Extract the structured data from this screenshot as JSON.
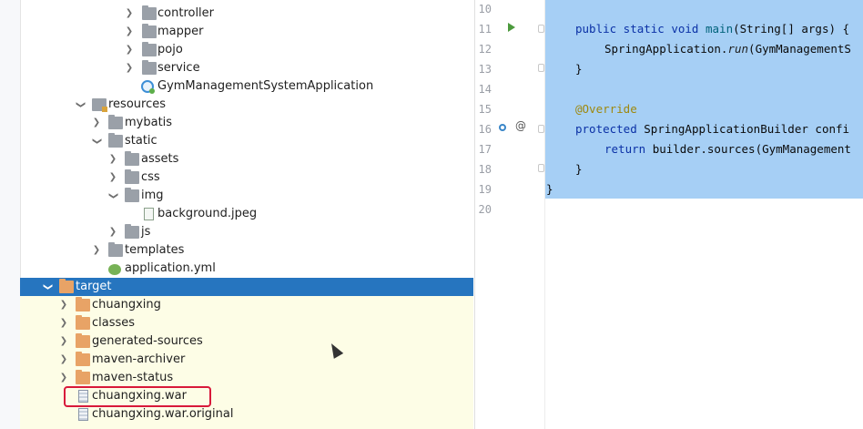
{
  "tree": {
    "items": [
      {
        "label": "controller",
        "type": "folder"
      },
      {
        "label": "mapper",
        "type": "folder"
      },
      {
        "label": "pojo",
        "type": "folder"
      },
      {
        "label": "service",
        "type": "folder"
      },
      {
        "label": "GymManagementSystemApplication",
        "type": "app-class"
      },
      {
        "label": "resources",
        "type": "resources-folder"
      },
      {
        "label": "mybatis",
        "type": "folder"
      },
      {
        "label": "static",
        "type": "folder"
      },
      {
        "label": "assets",
        "type": "folder"
      },
      {
        "label": "css",
        "type": "folder"
      },
      {
        "label": "img",
        "type": "folder"
      },
      {
        "label": "background.jpeg",
        "type": "file"
      },
      {
        "label": "js",
        "type": "folder"
      },
      {
        "label": "templates",
        "type": "folder"
      },
      {
        "label": "application.yml",
        "type": "yml"
      },
      {
        "label": "target",
        "type": "excluded-folder",
        "selected": true
      },
      {
        "label": "chuangxing",
        "type": "excluded-folder"
      },
      {
        "label": "classes",
        "type": "excluded-folder"
      },
      {
        "label": "generated-sources",
        "type": "excluded-folder"
      },
      {
        "label": "maven-archiver",
        "type": "excluded-folder"
      },
      {
        "label": "maven-status",
        "type": "excluded-folder"
      },
      {
        "label": "chuangxing.war",
        "type": "war",
        "highlighted": true
      },
      {
        "label": "chuangxing.war.original",
        "type": "war"
      }
    ]
  },
  "editor": {
    "line_numbers": [
      "10",
      "11",
      "12",
      "13",
      "14",
      "15",
      "16",
      "17",
      "18",
      "19",
      "20"
    ],
    "code": {
      "l11a": "public static void ",
      "l11b": "main",
      "l11c": "(String[] args) {",
      "l12a": "SpringApplication.",
      "l12b": "run",
      "l12c": "(GymManagementS",
      "l13": "}",
      "l15": "@Override",
      "l16a": "protected ",
      "l16b": "SpringApplicationBuilder ",
      "l16c": "confi",
      "l17a": "return ",
      "l17b": "builder.sources(GymManagement",
      "l18": "}",
      "l19": "}"
    },
    "gutter_icons": [
      "run-icon",
      "implements-icon",
      "annotation-icon"
    ]
  },
  "colors": {
    "selection": "#a6cff5",
    "tree_selection": "#2675bf",
    "excluded_bg": "#fdfde6",
    "highlight_box": "#d8193a",
    "keyword": "#0b31a6",
    "annotation": "#9e880d"
  }
}
